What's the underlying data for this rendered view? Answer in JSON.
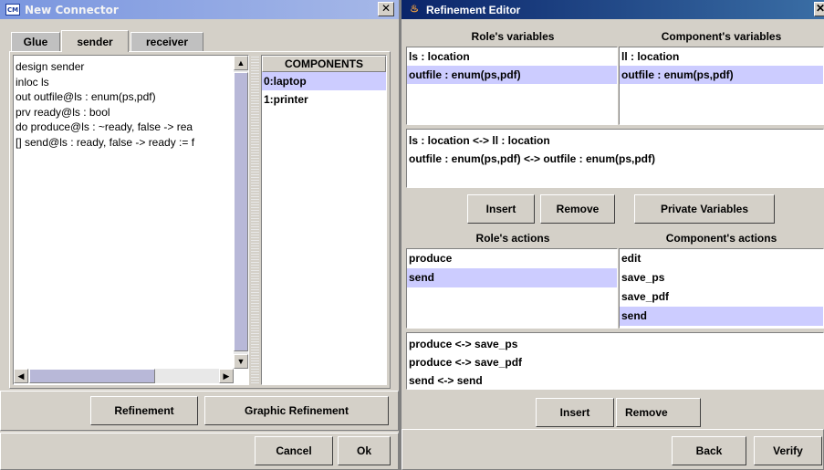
{
  "connector": {
    "title": "New Connector",
    "tabs": [
      "Glue",
      "sender",
      "receiver"
    ],
    "code_lines": [
      "design sender",
      "inloc ls",
      "out outfile@ls : enum(ps,pdf)",
      "prv ready@ls : bool",
      "do produce@ls : ~ready, false -> rea",
      "[] send@ls : ready, false -> ready := f"
    ],
    "components_header": "COMPONENTS",
    "components": [
      "0:laptop",
      "1:printer"
    ],
    "buttons": {
      "refinement": "Refinement",
      "graphic_refinement": "Graphic Refinement",
      "cancel": "Cancel",
      "ok": "Ok"
    }
  },
  "refinement": {
    "title": "Refinement Editor",
    "roles_vars_header": "Role's variables",
    "comp_vars_header": "Component's variables",
    "role_vars": [
      "ls : location",
      "outfile : enum(ps,pdf)"
    ],
    "comp_vars": [
      "ll : location",
      "outfile : enum(ps,pdf)"
    ],
    "var_mappings": [
      "ls : location <-> ll : location",
      "outfile : enum(ps,pdf) <-> outfile : enum(ps,pdf)"
    ],
    "buttons": {
      "insert": "Insert",
      "remove": "Remove",
      "private_vars": "Private Variables",
      "insert2": "Insert",
      "remove2": "Remove",
      "back": "Back",
      "verify": "Verify"
    },
    "role_actions_header": "Role's actions",
    "comp_actions_header": "Component's actions",
    "role_actions": [
      "produce",
      "send"
    ],
    "comp_actions": [
      "edit",
      "save_ps",
      "save_pdf",
      "send"
    ],
    "action_mappings": [
      "produce <-> save_ps",
      "produce <-> save_pdf",
      "send <-> send"
    ]
  },
  "colors": {
    "selection": "#ccccff",
    "window_bg": "#d4d0c8"
  }
}
